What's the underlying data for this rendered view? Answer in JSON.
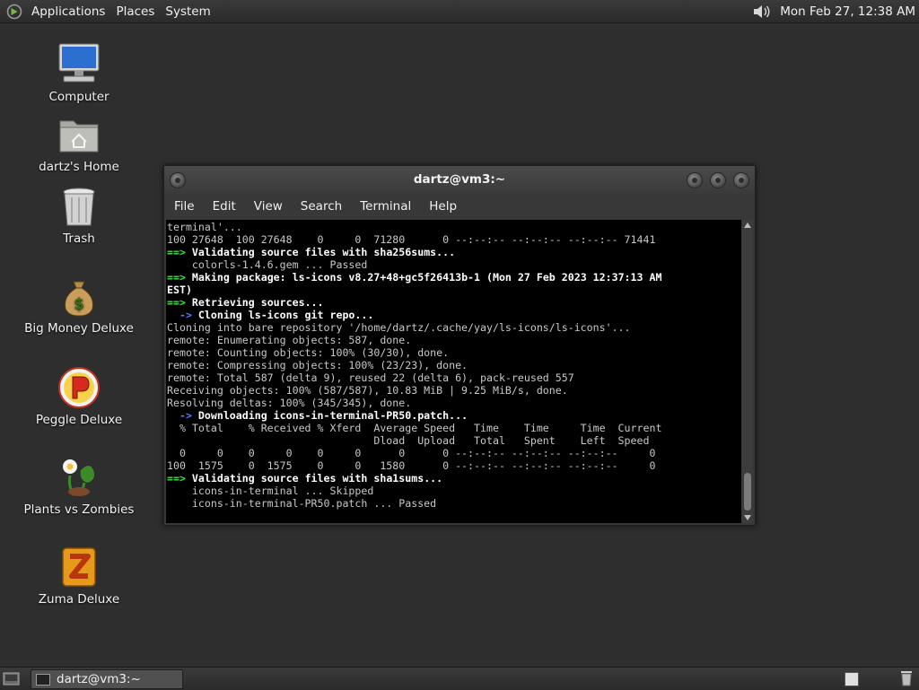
{
  "top_panel": {
    "menus": [
      "Applications",
      "Places",
      "System"
    ],
    "clock": "Mon Feb 27, 12:38 AM"
  },
  "desktop_icons": [
    {
      "label": "Computer",
      "icon": "computer-icon"
    },
    {
      "label": "dartz's Home",
      "icon": "home-folder-icon"
    },
    {
      "label": "Trash",
      "icon": "trash-icon"
    },
    {
      "label": "Big Money Deluxe",
      "icon": "money-bag-icon"
    },
    {
      "label": "Peggle Deluxe",
      "icon": "peggle-icon"
    },
    {
      "label": "Plants vs Zombies",
      "icon": "plants-vs-zombies-icon"
    },
    {
      "label": "Zuma Deluxe",
      "icon": "zuma-icon"
    }
  ],
  "terminal": {
    "title": "dartz@vm3:~",
    "menus": [
      "File",
      "Edit",
      "View",
      "Search",
      "Terminal",
      "Help"
    ],
    "lines": [
      [
        {
          "t": "terminal'..."
        }
      ],
      [
        {
          "t": "100 27648  100 27648    0     0  71280      0 --:--:-- --:--:-- --:--:-- 71441"
        }
      ],
      [
        {
          "t": "==>",
          "c": "g"
        },
        {
          "t": " Validating source files with sha256sums...",
          "c": "w"
        }
      ],
      [
        {
          "t": "    colorls-1.4.6.gem ... Passed"
        }
      ],
      [
        {
          "t": "==>",
          "c": "g"
        },
        {
          "t": " Making package: ls-icons v8.27+48+gc5f26413b-1 (Mon 27 Feb 2023 12:37:13 AM",
          "c": "w"
        }
      ],
      [
        {
          "t": "EST)",
          "c": "w"
        }
      ],
      [
        {
          "t": "==>",
          "c": "g"
        },
        {
          "t": " Retrieving sources...",
          "c": "w"
        }
      ],
      [
        {
          "t": "  ->",
          "c": "b"
        },
        {
          "t": " Cloning ls-icons git repo...",
          "c": "w"
        }
      ],
      [
        {
          "t": "Cloning into bare repository '/home/dartz/.cache/yay/ls-icons/ls-icons'..."
        }
      ],
      [
        {
          "t": "remote: Enumerating objects: 587, done."
        }
      ],
      [
        {
          "t": "remote: Counting objects: 100% (30/30), done."
        }
      ],
      [
        {
          "t": "remote: Compressing objects: 100% (23/23), done."
        }
      ],
      [
        {
          "t": "remote: Total 587 (delta 9), reused 22 (delta 6), pack-reused 557"
        }
      ],
      [
        {
          "t": "Receiving objects: 100% (587/587), 10.83 MiB | 9.25 MiB/s, done."
        }
      ],
      [
        {
          "t": "Resolving deltas: 100% (345/345), done."
        }
      ],
      [
        {
          "t": "  ->",
          "c": "b"
        },
        {
          "t": " Downloading icons-in-terminal-PR50.patch...",
          "c": "w"
        }
      ],
      [
        {
          "t": "  % Total    % Received % Xferd  Average Speed   Time    Time     Time  Current"
        }
      ],
      [
        {
          "t": "                                 Dload  Upload   Total   Spent    Left  Speed"
        }
      ],
      [
        {
          "t": "  0     0    0     0    0     0      0      0 --:--:-- --:--:-- --:--:--     0"
        }
      ],
      [
        {
          "t": "100  1575    0  1575    0     0   1580      0 --:--:-- --:--:-- --:--:--     0"
        }
      ],
      [
        {
          "t": "==>",
          "c": "g"
        },
        {
          "t": " Validating source files with sha1sums...",
          "c": "w"
        }
      ],
      [
        {
          "t": "    icons-in-terminal ... Skipped"
        }
      ],
      [
        {
          "t": "    icons-in-terminal-PR50.patch ... Passed"
        }
      ]
    ]
  },
  "taskbar": {
    "window_button_label": "dartz@vm3:~"
  }
}
